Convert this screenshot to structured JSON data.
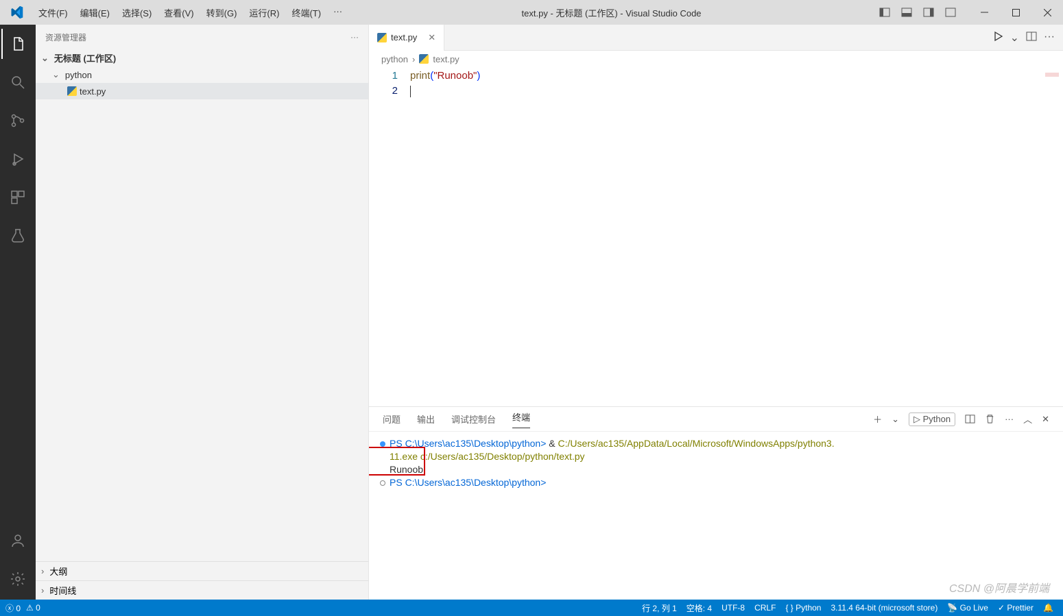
{
  "titlebar": {
    "menus": [
      "文件(F)",
      "编辑(E)",
      "选择(S)",
      "查看(V)",
      "转到(G)",
      "运行(R)",
      "终端(T)",
      "···"
    ],
    "title": "text.py - 无标题 (工作区) - Visual Studio Code"
  },
  "sidebar": {
    "title": "资源管理器",
    "section": "无标题 (工作区)",
    "folder": "python",
    "file": "text.py",
    "outline": "大纲",
    "timeline": "时间线"
  },
  "tabs": {
    "file": "text.py"
  },
  "breadcrumb": {
    "folder": "python",
    "file": "text.py"
  },
  "code": {
    "line_numbers": [
      "1",
      "2"
    ],
    "l1_fn": "print",
    "l1_open": "(",
    "l1_str": "\"Runoob\"",
    "l1_close": ")"
  },
  "panel": {
    "tabs": [
      "问题",
      "输出",
      "调试控制台",
      "终端"
    ],
    "shell_label": "Python",
    "term": {
      "l1a": "PS C:\\Users\\ac135\\Desktop\\python> ",
      "l1b": "& ",
      "l1c": "C:/Users/ac135/AppData/Local/Microsoft/WindowsApps/python3.",
      "l2": "11.exe c:/Users/ac135/Desktop/python/text.py",
      "l3": "Runoob",
      "l4": "PS C:\\Users\\ac135\\Desktop\\python>"
    }
  },
  "statusbar": {
    "errors": "0",
    "warnings": "0",
    "cursor": "行 2, 列 1",
    "spaces": "空格: 4",
    "encoding": "UTF-8",
    "eol": "CRLF",
    "lang": "Python",
    "interpreter": "3.11.4 64-bit (microsoft store)",
    "golive": "Go Live",
    "prettier": "Prettier"
  },
  "watermark": "CSDN @阿晨学前端"
}
